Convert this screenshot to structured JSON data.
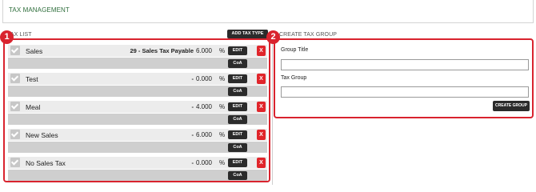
{
  "header": {
    "title": "TAX MANAGEMENT"
  },
  "tax_list": {
    "label": "TAX LIST",
    "add_button": "ADD TAX TYPE",
    "edit_label": "EDIT",
    "delete_label": "X",
    "coa_label": "CoA",
    "percent_symbol": "%",
    "items": [
      {
        "name": "Sales",
        "account": "29 - Sales Tax Payable",
        "rate": "6.000",
        "checked": true
      },
      {
        "name": "Test",
        "account": "-",
        "rate": "0.000",
        "checked": true
      },
      {
        "name": "Meal",
        "account": "-",
        "rate": "4.000",
        "checked": true
      },
      {
        "name": "New Sales",
        "account": "-",
        "rate": "6.000",
        "checked": true
      },
      {
        "name": "No Sales Tax",
        "account": "-",
        "rate": "0.000",
        "checked": true
      }
    ]
  },
  "tax_group": {
    "label": "CREATE TAX GROUP",
    "group_title_label": "Group Title",
    "group_title_value": "",
    "tax_group_label": "Tax Group",
    "tax_group_value": "",
    "create_button": "CREATE GROUP"
  },
  "annotations": {
    "badge_1": "1",
    "badge_2": "2",
    "badge_color": "#d9232e"
  },
  "colors": {
    "header_title": "#2f6e3c",
    "button_dark": "#2b2b2b",
    "delete_red": "#e0252b",
    "row_light": "#ececec",
    "row_dark": "#cfcfcf"
  }
}
